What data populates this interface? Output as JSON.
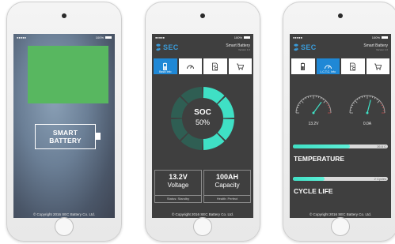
{
  "colors": {
    "accent": "#1f88d6",
    "green_block": "#58b760",
    "ring_active": "#3fe0c5",
    "ring_inactive": "#2f5e53",
    "screen_bg": "#3f3f3f"
  },
  "status_bar": {
    "carrier": "●●●●● ",
    "battery_pct": "100%"
  },
  "copyright": "© Copyright 2016 SEC Battery Co. Ltd.",
  "screen1": {
    "brand_line1": "SMART",
    "brand_line2": "BATTERY"
  },
  "app": {
    "logo_text": "SEC",
    "title": "Smart Battery",
    "version": "Version 1.0"
  },
  "tabs": {
    "basic": {
      "icon": "battery-icon",
      "label": "Basic Info"
    },
    "gauge": {
      "icon": "speedometer-icon"
    },
    "doc": {
      "icon": "document-settings-icon"
    },
    "cart": {
      "icon": "shopping-cart-icon"
    },
    "lcc": {
      "icon": "speedometer-icon",
      "label": "L.C.T.C. Info"
    }
  },
  "soc": {
    "title": "SOC",
    "value": "50%",
    "fraction": 0.5
  },
  "voltage_card": {
    "value": "13.2V",
    "label": "Voltage",
    "footer": "Status: Standby"
  },
  "capacity_card": {
    "value": "100AH",
    "label": "Capacity",
    "footer": "Health: Perfect"
  },
  "gauges": {
    "voltage_reading": "13.2V",
    "current_reading": "0.0A"
  },
  "temperature": {
    "title": "TEMPERATURE",
    "value": "26.6 C",
    "fraction": 0.6
  },
  "cycle": {
    "title": "CYCLE LIFE",
    "value": "2 Cycles",
    "fraction": 0.33
  }
}
